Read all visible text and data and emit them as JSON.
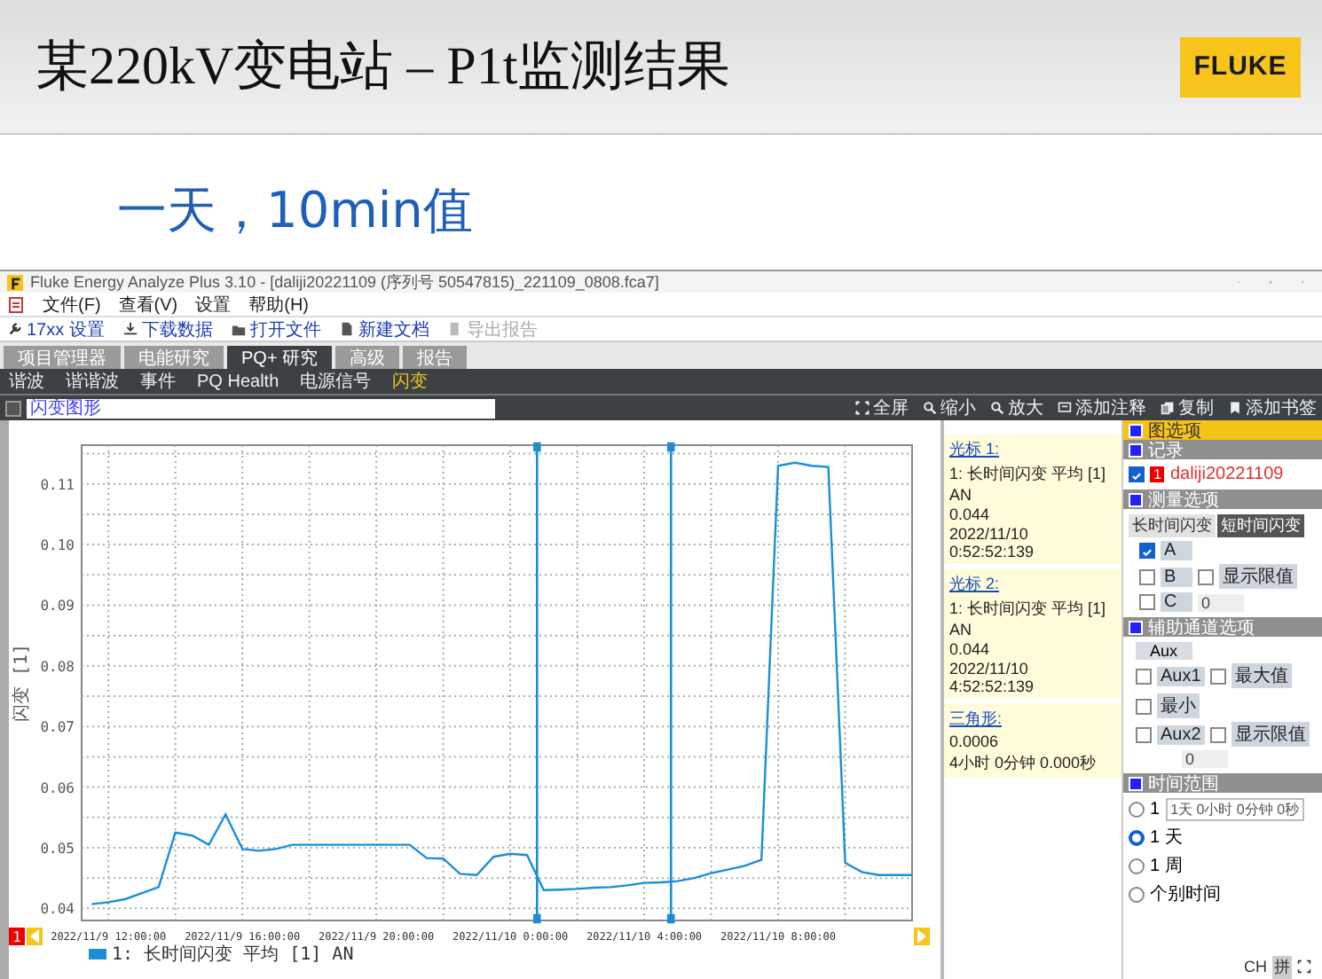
{
  "slide": {
    "title": "某220kV变电站 – P1t监测结果",
    "logo": "FLUKE",
    "subtitle": "一天，10min值"
  },
  "window": {
    "title": "Fluke Energy Analyze Plus 3.10 - [daliji20221109 (序列号 50547815)_221109_0808.fca7]"
  },
  "menu": [
    "文件(F)",
    "查看(V)",
    "设置",
    "帮助(H)"
  ],
  "toolbar": [
    {
      "label": "17xx 设置",
      "kind": "wrench",
      "disabled": false
    },
    {
      "label": "下载数据",
      "kind": "download",
      "disabled": false
    },
    {
      "label": "打开文件",
      "kind": "folder",
      "disabled": false
    },
    {
      "label": "新建文档",
      "kind": "doc",
      "disabled": false
    },
    {
      "label": "导出报告",
      "kind": "export",
      "disabled": true
    }
  ],
  "tabs": [
    {
      "label": "项目管理器",
      "selected": false
    },
    {
      "label": "电能研究",
      "selected": false
    },
    {
      "label": "PQ+ 研究",
      "selected": true
    },
    {
      "label": "高级",
      "selected": false
    },
    {
      "label": "报告",
      "selected": false
    }
  ],
  "subtabs": [
    {
      "label": "谐波",
      "selected": false
    },
    {
      "label": "谐谐波",
      "selected": false
    },
    {
      "label": "事件",
      "selected": false
    },
    {
      "label": "PQ Health",
      "selected": false
    },
    {
      "label": "电源信号",
      "selected": false
    },
    {
      "label": "闪变",
      "selected": true
    }
  ],
  "search": {
    "checked": false,
    "value": "闪变图形"
  },
  "view_tools": [
    {
      "label": "全屏",
      "kind": "fullscreen"
    },
    {
      "label": "缩小",
      "kind": "zoom"
    },
    {
      "label": "放大",
      "kind": "zoom"
    },
    {
      "label": "添加注释",
      "kind": "note"
    },
    {
      "label": "复制",
      "kind": "copy"
    },
    {
      "label": "添加书签",
      "kind": "bookmark"
    }
  ],
  "chart": {
    "badge": "1",
    "chart_data": {
      "type": "line",
      "ylabel": "闪变 [1]",
      "categories": [
        null,
        "2022/11/9 12:00:00",
        null,
        null,
        null,
        null,
        null,
        null,
        null,
        "2022/11/9 16:00:00",
        null,
        null,
        null,
        null,
        null,
        null,
        null,
        "2022/11/9 20:00:00",
        null,
        null,
        null,
        null,
        null,
        null,
        null,
        "2022/11/10 0:00:00",
        null,
        null,
        null,
        null,
        null,
        null,
        null,
        "2022/11/10 4:00:00",
        null,
        null,
        null,
        null,
        null,
        null,
        null,
        "2022/11/10 8:00:00",
        null,
        null,
        null,
        null,
        null,
        null,
        null,
        null
      ],
      "series": [
        {
          "name": "1: 长时间闪变 平均 [1] AN",
          "color": "#1a8fd6",
          "values": [
            0.0407,
            0.041,
            0.0415,
            0.0425,
            0.0435,
            0.0525,
            0.052,
            0.0505,
            0.0555,
            0.0498,
            0.0495,
            0.0498,
            0.0505,
            0.0505,
            0.0505,
            0.0505,
            0.0505,
            0.0505,
            0.0505,
            0.0505,
            0.0483,
            0.0482,
            0.0457,
            0.0455,
            0.0485,
            0.049,
            0.0488,
            0.043,
            0.0431,
            0.0432,
            0.0434,
            0.0435,
            0.0438,
            0.0442,
            0.0443,
            0.0445,
            0.045,
            0.0458,
            0.0464,
            0.047,
            0.048,
            0.113,
            0.1135,
            0.113,
            0.1128,
            0.0475,
            0.046,
            0.0455,
            0.0455,
            0.0455
          ]
        }
      ],
      "ylim": [
        0.038,
        0.1164
      ],
      "grid": true,
      "yticks": [
        {
          "value": 0.04,
          "label": "0.04"
        },
        {
          "value": 0.05,
          "label": "0.05"
        },
        {
          "value": 0.06,
          "label": "0.06"
        },
        {
          "value": 0.07,
          "label": "0.07"
        },
        {
          "value": 0.08,
          "label": "0.08"
        },
        {
          "value": 0.09,
          "label": "0.09"
        },
        {
          "value": 0.1,
          "label": "0.10"
        },
        {
          "value": 0.11,
          "label": "0.11"
        }
      ]
    }
  },
  "cursors": [
    {
      "title": "光标 1:",
      "series": "1: 长时间闪变 平均 [1] AN",
      "value": "0.044",
      "time": "2022/11/10 0:52:52:139"
    },
    {
      "title": "光标 2:",
      "series": "1: 长时间闪变 平均 [1] AN",
      "value": "0.044",
      "time": "2022/11/10 4:52:52:139"
    },
    {
      "title": "三角形:",
      "value": "0.0006",
      "time": "4小时 0分钟 0.000秒"
    }
  ],
  "panel": [
    {
      "kind": "title",
      "header": "图选项"
    },
    {
      "kind": "records",
      "header": "记录",
      "record": {
        "checked": true,
        "badge": "1",
        "name": "daliji20221109"
      }
    },
    {
      "kind": "measurement",
      "header": "测量选项",
      "tabs": [
        {
          "label": "长时间闪变",
          "selected": false
        },
        {
          "label": "短时间闪变",
          "selected": true
        }
      ],
      "channels": [
        {
          "label": "A",
          "checked": true
        },
        {
          "label": "B",
          "checked": false
        },
        {
          "label": "C",
          "checked": false
        }
      ],
      "limit": {
        "label": "显示限值",
        "checked": false,
        "value": "0"
      }
    },
    {
      "kind": "aux",
      "header": "辅助通道选项",
      "button": "Aux",
      "channels": [
        {
          "label": "Aux1",
          "checked": false
        },
        {
          "label": "Aux2",
          "checked": false
        }
      ],
      "options": [
        {
          "label": "最大值",
          "checked": false
        },
        {
          "label": "最小",
          "checked": false
        },
        {
          "label": "显示限值",
          "checked": false
        }
      ],
      "value": "0"
    },
    {
      "kind": "time",
      "header": "时间范围",
      "options": [
        {
          "label": "1",
          "selected": false,
          "dropdown": "1天 0小时 0分钟 0秒"
        },
        {
          "label": "1 天",
          "selected": true
        },
        {
          "label": "1 周",
          "selected": false
        },
        {
          "label": "个别时间",
          "selected": false
        }
      ]
    }
  ],
  "status": [
    "CH",
    "拼"
  ]
}
